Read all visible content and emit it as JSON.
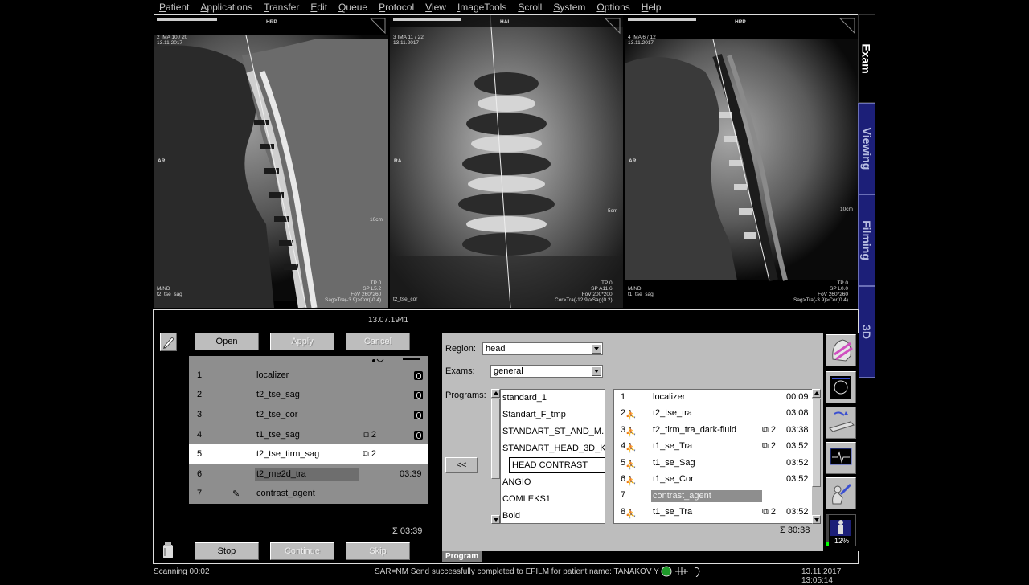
{
  "menu": [
    "Patient",
    "Applications",
    "Transfer",
    "Edit",
    "Queue",
    "Protocol",
    "View",
    "ImageTools",
    "Scroll",
    "System",
    "Options",
    "Help"
  ],
  "panes": [
    {
      "top_label": "HRP",
      "info": "2 IMA 10 / 20\n13.11.2017",
      "side": "AR",
      "scale": "10cm",
      "bl": "M/ND\nt2_tse_sag",
      "br": "TP 0\nSP L5.2\nFoV 260*260\nSag>Tra(-3.9)>Cor(-0.4)"
    },
    {
      "top_label": "HAL",
      "info": "3 IMA 11 / 22\n13.11.2017",
      "side": "RA",
      "scale": "5cm",
      "bl": "t2_tse_cor",
      "br": "TP 0\nSP A11.6\nFoV 200*200\nCor>Tra(-12.9)>Sag(0.2)"
    },
    {
      "top_label": "HRP",
      "info": "4 IMA 6 / 12\n13.11.2017",
      "side": "AR",
      "scale": "10cm",
      "bl": "M/ND\nt1_tse_sag",
      "br": "TP 0\nSP L0.0\nFoV 260*260\nSag>Tra(-3.9)>Cor(0.4)"
    }
  ],
  "tabs": [
    "Exam",
    "Viewing",
    "Filming",
    "3D"
  ],
  "dob": "13.07.1941",
  "queue_buttons": {
    "open": "Open",
    "apply": "Apply",
    "cancel": "Cancel"
  },
  "queue": [
    {
      "n": "1",
      "name": "localizer",
      "extra": "",
      "time": ""
    },
    {
      "n": "2",
      "name": "t2_tse_sag",
      "extra": "",
      "time": ""
    },
    {
      "n": "3",
      "name": "t2_tse_cor",
      "extra": "",
      "time": ""
    },
    {
      "n": "4",
      "name": "t1_tse_sag",
      "extra": "2",
      "time": ""
    },
    {
      "n": "5",
      "name": "t2_tse_tirm_sag",
      "extra": "2",
      "time": ""
    },
    {
      "n": "6",
      "name": "t2_me2d_tra",
      "extra": "",
      "time": "03:39"
    },
    {
      "n": "7",
      "name": "contrast_agent",
      "extra": "",
      "time": ""
    }
  ],
  "queue_total": "Σ 03:39",
  "control_buttons": {
    "stop": "Stop",
    "continue": "Continue",
    "skip": "Skip"
  },
  "protocol": {
    "region_label": "Region:",
    "region_value": "head",
    "exams_label": "Exams:",
    "exams_value": "general",
    "programs_label": "Programs:",
    "programs": [
      "standard_1",
      "Standart_F_tmp",
      "STANDART_ST_AND_M...",
      "STANDART_HEAD_3D_K",
      "HEAD CONTRAST",
      "ANGIO",
      "COMLEKS1",
      "Bold"
    ],
    "back_button": "<<",
    "steps": [
      {
        "n": "1",
        "name": "localizer",
        "extra": "",
        "time": "00:09"
      },
      {
        "n": "2",
        "name": "t2_tse_tra",
        "extra": "",
        "time": "03:08"
      },
      {
        "n": "3",
        "name": "t2_tirm_tra_dark-fluid",
        "extra": "2",
        "time": "03:38"
      },
      {
        "n": "4",
        "name": "t1_se_Tra",
        "extra": "2",
        "time": "03:52"
      },
      {
        "n": "5",
        "name": "t1_se_Sag",
        "extra": "",
        "time": "03:52"
      },
      {
        "n": "6",
        "name": "t1_se_Cor",
        "extra": "",
        "time": "03:52"
      },
      {
        "n": "7",
        "name": "contrast_agent",
        "extra": "",
        "time": ""
      },
      {
        "n": "8",
        "name": "t1_se_Tra",
        "extra": "2",
        "time": "03:52"
      }
    ],
    "total": "Σ 30:38",
    "tab": "Program"
  },
  "progress_pct": "12%",
  "status": {
    "left": "Scanning 00:02",
    "msg": "SAR=NM Send successfully completed to EFILM for patient name: TANAKOV Y",
    "datetime": "13.11.2017 13:05:14"
  },
  "colors": {
    "tab_bg": "#1c1f78",
    "panel": "#bdbdbd",
    "queue": "#8e8e8e"
  }
}
